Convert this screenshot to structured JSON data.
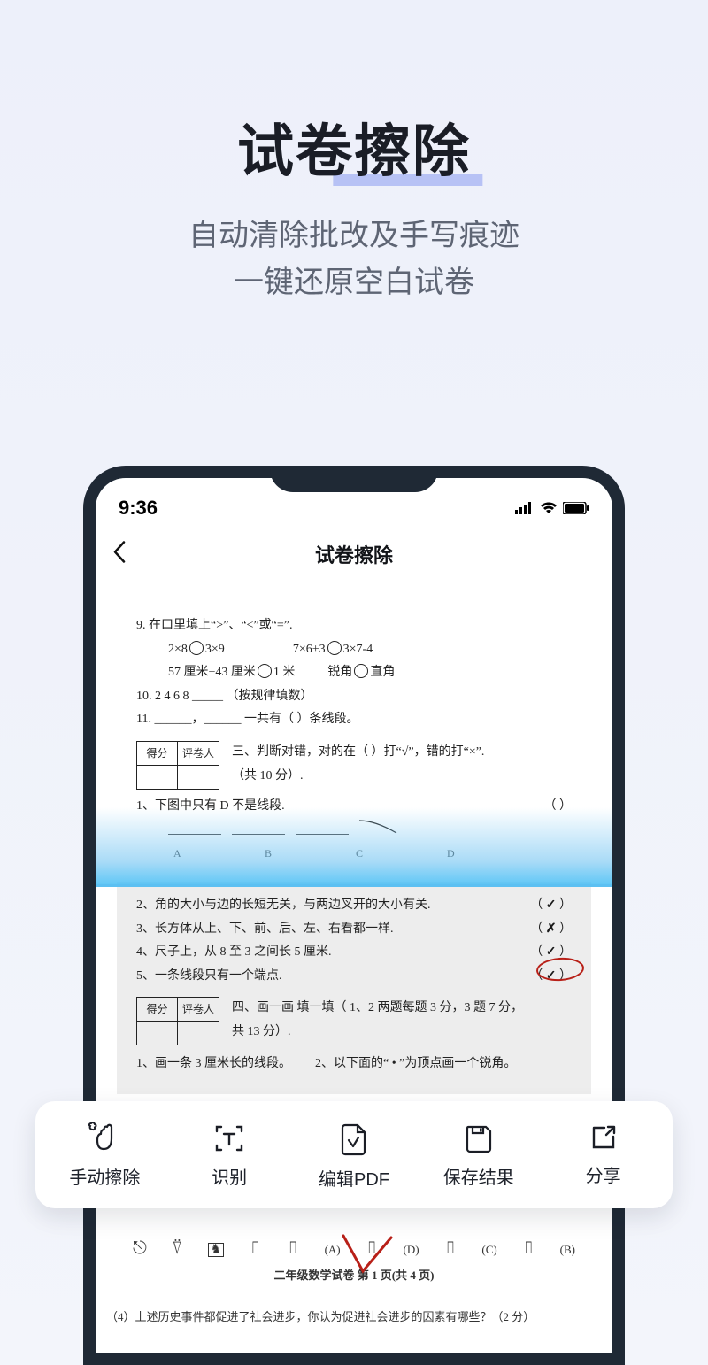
{
  "hero": {
    "title": "试卷擦除",
    "sub1": "自动清除批改及手写痕迹",
    "sub2": "一键还原空白试卷"
  },
  "status": {
    "time": "9:36"
  },
  "header": {
    "title": "试卷擦除"
  },
  "doc_clean": {
    "q9_prefix": "9.  在口里填上“>”、“<”或“=”.",
    "q9_a": "2×8",
    "q9_b": "3×9",
    "q9_c": "7×6+3",
    "q9_d": "3×7-4",
    "q9_e": "57 厘米+43 厘米",
    "q9_f": "1 米",
    "q9_g": "锐角",
    "q9_h": "直角",
    "q10": "10.  2   4   6   8  _____  （按规律填数）",
    "q11": "11.  ______，______  一共有（     ）条线段。",
    "score_a": "得分",
    "score_b": "评卷人",
    "section3": "三、判断对错，对的在（    ）打“√”，错的打“×”.",
    "section3b": "（共 10 分）.",
    "j1": "1、下图中只有 D 不是线段.",
    "j1_paren": "（         ）",
    "labels": "A                   B                   C                   D"
  },
  "doc_dirty": {
    "j2": "2、角的大小与边的长短无关，与两边叉开的大小有关.",
    "j3": "3、长方体从上、下、前、后、左、右看都一样.",
    "j4": "4、尺子上，从 8 至 3 之间长 5 厘米.",
    "j5": "5、一条线段只有一个端点.",
    "score_a": "得分",
    "score_b": "评卷人",
    "section4": "四、画一画  填一填（ 1、2 两题每题 3 分，3 题 7 分，",
    "section4b": "共 13 分）.",
    "d1": "1、画一条 3 厘米长的线段。",
    "d2": "2、以下面的“ •  ”为顶点画一个锐角。"
  },
  "tail": {
    "footer": "二年级数学试卷    第 1 页(共 4 页)",
    "q4": "（4）上述历史事件都促进了社会进步，你认为促进社会进步的因素有哪些？（2 分）",
    "opt_a": "(A)",
    "opt_b": "(B)",
    "opt_c": "(C)",
    "opt_d": "(D)",
    "opt_b2": "(B)"
  },
  "toolbar": {
    "erase": "手动擦除",
    "ocr": "识别",
    "pdf": "编辑PDF",
    "save": "保存结果",
    "share": "分享"
  }
}
